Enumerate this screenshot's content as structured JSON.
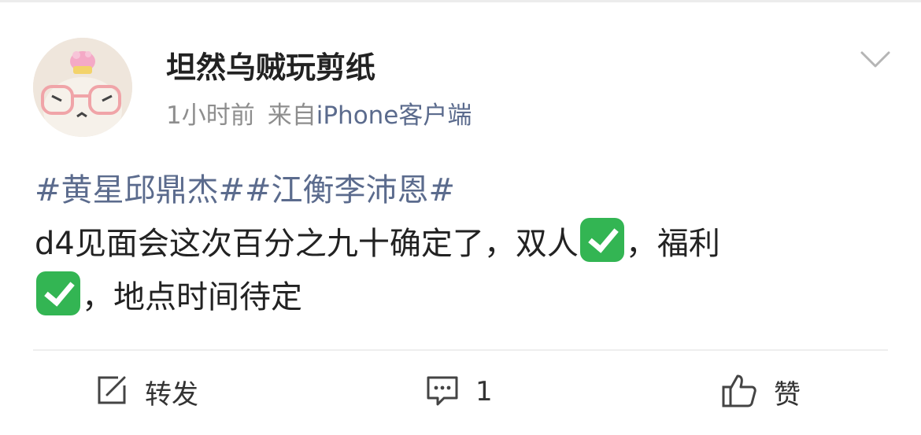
{
  "post": {
    "author": {
      "name": "坦然乌贼玩剪纸"
    },
    "meta": {
      "time": "1小时前",
      "source_label": "来自",
      "source_client": "iPhone客户端"
    },
    "content": {
      "hashtags": "#黄星邱鼎杰##江衡李沛恩#",
      "line1": "d4见面会这次百分之九十确定了，双人",
      "seg2": "，福利",
      "seg3": "，地点时间待定"
    },
    "actions": {
      "repost_label": "转发",
      "comment_count": "1",
      "like_label": "赞"
    },
    "colors": {
      "link": "#5b6b8d",
      "meta_gray": "#8e8e8e",
      "check_green": "#33b553"
    },
    "icons": [
      "avatar",
      "chevron-down-icon",
      "check-mark-emoji",
      "repost-icon",
      "comment-icon",
      "like-icon"
    ]
  }
}
